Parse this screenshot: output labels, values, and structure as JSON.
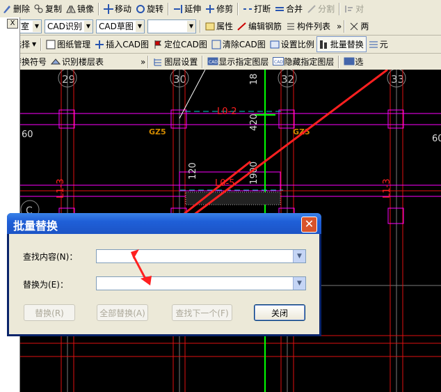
{
  "toolbar1": {
    "items": [
      {
        "label": "删除",
        "icon": "delete-icon"
      },
      {
        "label": "复制",
        "icon": "copy-icon"
      },
      {
        "label": "镜像",
        "icon": "mirror-icon"
      },
      {
        "label": "移动",
        "icon": "move-icon"
      },
      {
        "label": "旋转",
        "icon": "rotate-icon"
      },
      {
        "label": "延伸",
        "icon": "extend-icon"
      },
      {
        "label": "修剪",
        "icon": "trim-icon"
      },
      {
        "label": "打断",
        "icon": "break-icon"
      },
      {
        "label": "合并",
        "icon": "merge-icon"
      },
      {
        "label": "分割",
        "icon": "split-icon"
      },
      {
        "label": "对",
        "icon": "align-icon"
      }
    ]
  },
  "toolbar2": {
    "floor_select": "地下室",
    "mode_select": "CAD识别",
    "view_select": "CAD草图",
    "blank_select": "",
    "attr_label": "属性",
    "edit_rebar_label": "编辑钢筋",
    "component_list_label": "构件列表",
    "extra_label": "两"
  },
  "toolbar3": {
    "select_label": "选择",
    "drawing_manage_label": "图纸管理",
    "insert_cad_label": "插入CAD图",
    "locate_cad_label": "定位CAD图",
    "clear_cad_label": "清除CAD图",
    "set_scale_label": "设置比例",
    "batch_replace_label": "批量替换",
    "extra_label": "元"
  },
  "toolbar4": {
    "convert_symbol_label": "转换符号",
    "identify_floor_label": "识别楼层表",
    "layer_settings_label": "图层设置",
    "show_layer_label": "显示指定图层",
    "hide_layer_label": "隐藏指定图层",
    "select_label": "选"
  },
  "left_panel": {
    "close_label": "X"
  },
  "cad": {
    "axis_labels": [
      "29",
      "30",
      "32",
      "33"
    ],
    "axis_top_numbers": [
      "18"
    ],
    "dims": [
      "420",
      "1900",
      "120"
    ],
    "beam_labels": [
      "L0-2",
      "L0-5"
    ],
    "column_labels": [
      "GZ5",
      "GZ5"
    ],
    "side_labels": [
      "L1-3",
      "L1-3"
    ],
    "left_number": "60",
    "right_number": "60",
    "left_axis_partial": "C"
  },
  "dialog": {
    "title": "批量替换",
    "close_icon": "close-icon",
    "find_label": "查找内容(N)：",
    "find_value": "",
    "replace_label": "替换为(E)：",
    "replace_value": "",
    "replace_button": "替换(R)",
    "replace_all_button": "全部替换(A)",
    "find_next_button": "查找下一个(F)",
    "close_button": "关闭"
  },
  "colors": {
    "canvas_bg": "#000000",
    "magenta_line": "#ff00ff",
    "red_line": "#ff0000",
    "green_line": "#00ff00",
    "axis_gray": "#808080",
    "annotation_arrow": "#ff2020",
    "title_bar_blue": "#1f5fd8"
  }
}
